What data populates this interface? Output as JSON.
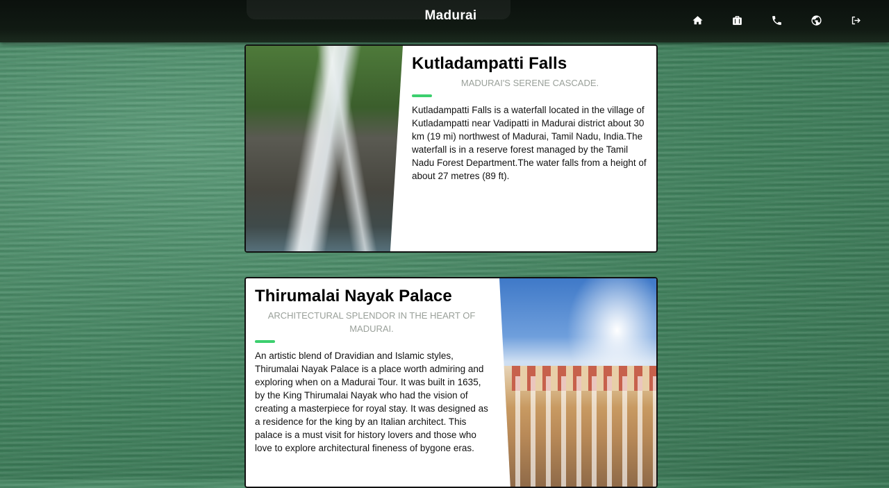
{
  "header": {
    "title": "Madurai",
    "nav": [
      {
        "icon": "home-icon"
      },
      {
        "icon": "briefcase-icon"
      },
      {
        "icon": "phone-icon"
      },
      {
        "icon": "globe-icon"
      },
      {
        "icon": "logout-icon"
      }
    ]
  },
  "places": [
    {
      "title": "Kutladampatti Falls",
      "subtitle": "MADURAI'S SERENE CASCADE.",
      "description": "Kutladampatti Falls is a waterfall located in the village of Kutladampatti near Vadipatti in Madurai district about 30 km (19 mi) northwest of Madurai, Tamil Nadu, India.The waterfall is in a reserve forest managed by the Tamil Nadu Forest Department.The water falls from a height of about 27 metres (89 ft)."
    },
    {
      "title": "Thirumalai Nayak Palace",
      "subtitle": "ARCHITECTURAL SPLENDOR IN THE HEART OF MADURAI.",
      "description": "An artistic blend of Dravidian and Islamic styles, Thirumalai Nayak Palace is a place worth admiring and exploring when on a Madurai Tour. It was built in 1635, by the King Thirumalai Nayak who had the vision of creating a masterpiece for royal stay. It was designed as a residence for the king by an Italian architect. This palace is a must visit for history lovers and those who love to explore architectural fineness of bygone eras."
    }
  ],
  "colors": {
    "accent": "#3ccf6e",
    "header_bg": "#0b110d",
    "subtitle": "#9aa09a"
  }
}
